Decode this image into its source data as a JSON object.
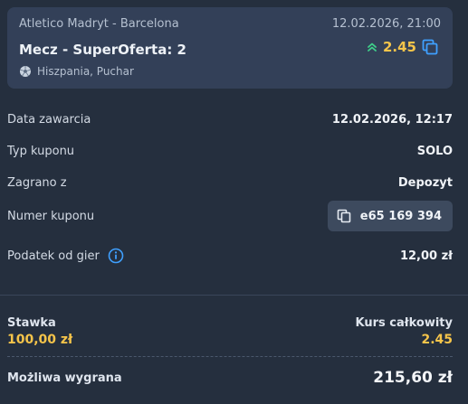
{
  "event": {
    "teams": "Atletico Madryt - Barcelona",
    "datetime": "12.02.2026, 21:00",
    "market": "Mecz - SuperOferta: 2",
    "odds": "2.45",
    "league": "Hiszpania, Puchar",
    "odds_color": "#f5c44a",
    "trend_color": "#3fd08a",
    "boost_icon_color": "#3fa0ff"
  },
  "details": {
    "date_label": "Data zawarcia",
    "date_value": "12.02.2026, 12:17",
    "type_label": "Typ kuponu",
    "type_value": "SOLO",
    "source_label": "Zagrano z",
    "source_value": "Depozyt",
    "coupon_label": "Numer kuponu",
    "coupon_value": "e65 169 394",
    "tax_label": "Podatek od gier",
    "tax_value": "12,00 zł"
  },
  "summary": {
    "stake_label": "Stawka",
    "stake_value": "100,00 zł",
    "total_odds_label": "Kurs całkowity",
    "total_odds_value": "2.45",
    "win_label": "Możliwa wygrana",
    "win_value": "215,60 zł"
  },
  "icons": {
    "trend": "double-chevron-up-icon",
    "boost": "square-copy-icon",
    "league": "football-icon",
    "copy": "copy-icon",
    "info": "info-icon"
  },
  "colors": {
    "background": "#252f3e",
    "card": "#334058",
    "accent": "#f5c44a",
    "info": "#3fa0ff"
  }
}
